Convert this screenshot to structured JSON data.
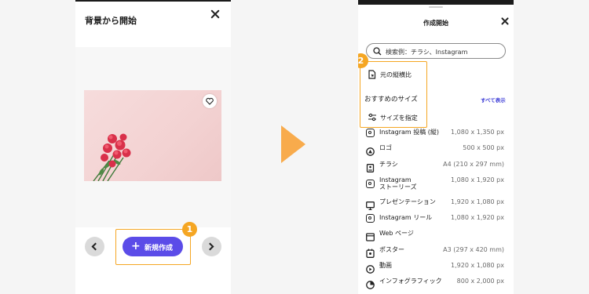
{
  "left_panel": {
    "title": "背景から開始",
    "new_design_label": "新規作成",
    "step_badge": "1"
  },
  "right_panel": {
    "title": "作成開始",
    "step_badge": "2",
    "search": {
      "placeholder": "検索例：チラシ、Instagram"
    },
    "options": {
      "aspect_label": "元の縦横比",
      "custom_label": "サイズを指定"
    },
    "recommended_title": "おすすめのサイズ",
    "show_all_label": "すべて表示",
    "sizes": [
      {
        "name": "Instagram 投稿 (縦)",
        "dims": "1,080 x 1,350 px",
        "icon": "instagram-icon"
      },
      {
        "name": "ロゴ",
        "dims": "500 x 500 px",
        "icon": "logo-icon"
      },
      {
        "name": "チラシ",
        "dims": "A4 (210 x 297 mm)",
        "icon": "flyer-icon"
      },
      {
        "name": "Instagram\nストーリーズ",
        "dims": "1,080 x 1,920 px",
        "icon": "instagram-icon"
      },
      {
        "name": "プレゼンテーション",
        "dims": "1,920 x 1,080 px",
        "icon": "presentation-icon"
      },
      {
        "name": "Instagram リール",
        "dims": "1,080 x 1,920 px",
        "icon": "instagram-icon"
      },
      {
        "name": "Web ページ",
        "dims": "",
        "icon": "webpage-icon"
      },
      {
        "name": "ポスター",
        "dims": "A3 (297 x 420 mm)",
        "icon": "poster-icon"
      },
      {
        "name": "動画",
        "dims": "1,920 x 1,080 px",
        "icon": "video-icon"
      },
      {
        "name": "インフォグラフィック",
        "dims": "800 x 2,000 px",
        "icon": "infographic-icon"
      }
    ]
  },
  "colors": {
    "accent": "#5b4ce8",
    "highlight": "#f5a623",
    "arrow": "#f8ab4c",
    "link": "#3b3bd6"
  }
}
